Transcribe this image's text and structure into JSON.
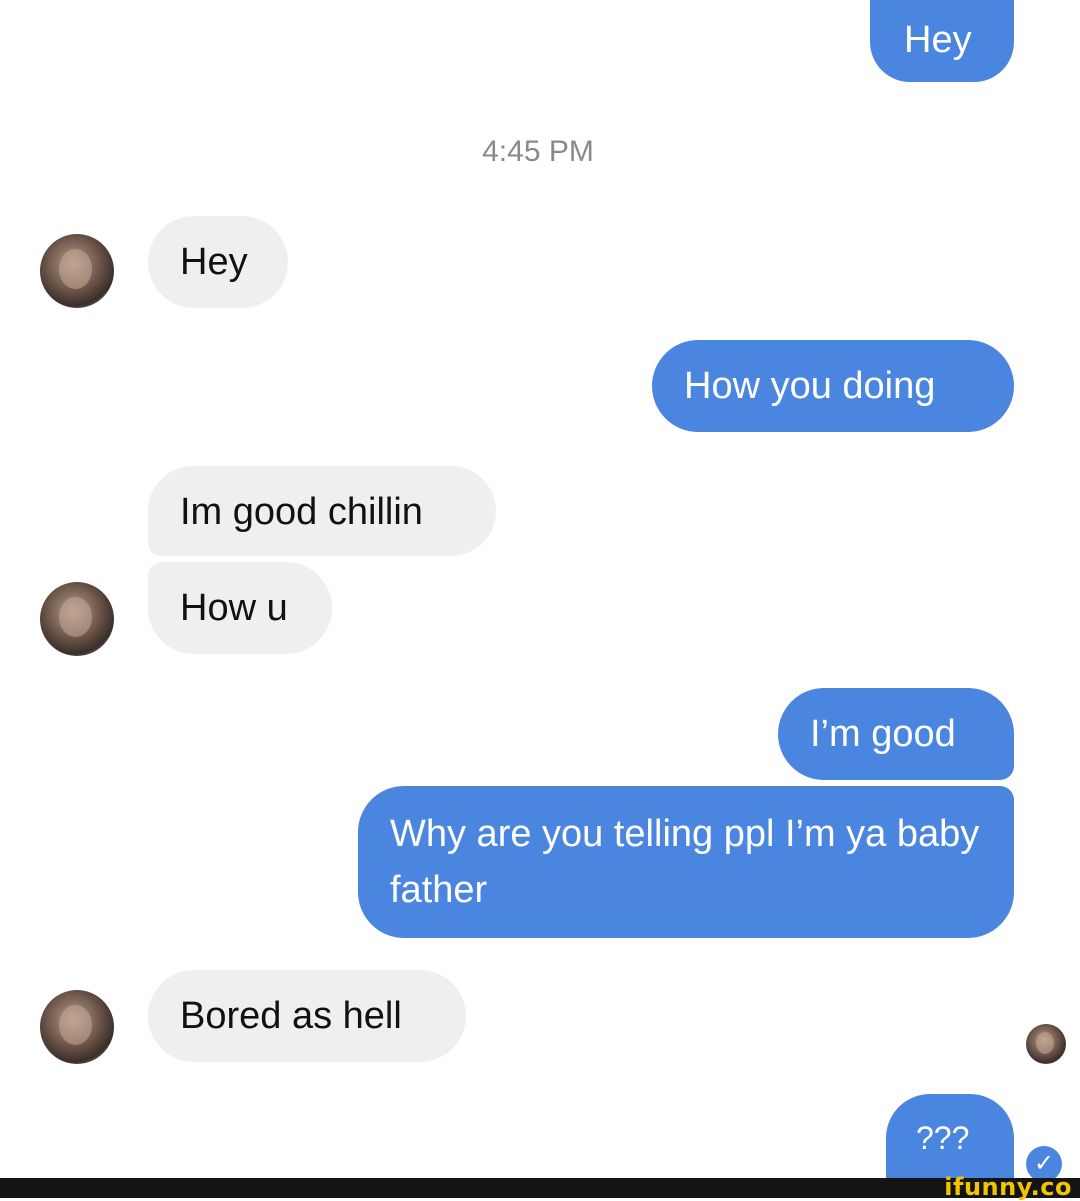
{
  "conversation": {
    "timestamp": "4:45 PM",
    "messages": [
      {
        "from": "me",
        "text": "Hey"
      },
      {
        "from": "them",
        "text": "Hey"
      },
      {
        "from": "me",
        "text": "How you doing"
      },
      {
        "from": "them",
        "text": "Im good chillin"
      },
      {
        "from": "them",
        "text": "How u"
      },
      {
        "from": "me",
        "text": "I’m good"
      },
      {
        "from": "me",
        "text": "Why are you telling ppl I’m ya baby father"
      },
      {
        "from": "them",
        "text": "Bored as hell"
      },
      {
        "from": "me",
        "text": "???"
      }
    ]
  },
  "colors": {
    "outgoing_bubble": "#4a86e0",
    "incoming_bubble": "#efefef",
    "watermark": "#f5c400"
  },
  "icons": {
    "read_receipt": "checkmark-icon",
    "avatar": "contact-avatar"
  },
  "watermark": {
    "text": "ifunny.co"
  }
}
